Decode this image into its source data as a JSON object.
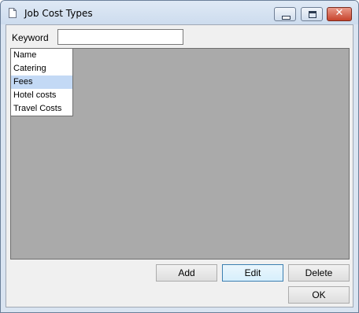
{
  "window": {
    "title": "Job Cost Types",
    "close_glyph": "✕"
  },
  "keyword": {
    "label": "Keyword",
    "value": ""
  },
  "list": {
    "header": "Name",
    "items": [
      "Catering",
      "Fees",
      "Hotel costs",
      "Travel Costs"
    ],
    "selected_index": 1
  },
  "buttons": {
    "add": "Add",
    "edit": "Edit",
    "delete": "Delete",
    "ok": "OK"
  },
  "icons": {
    "title_icon": "document-icon"
  }
}
